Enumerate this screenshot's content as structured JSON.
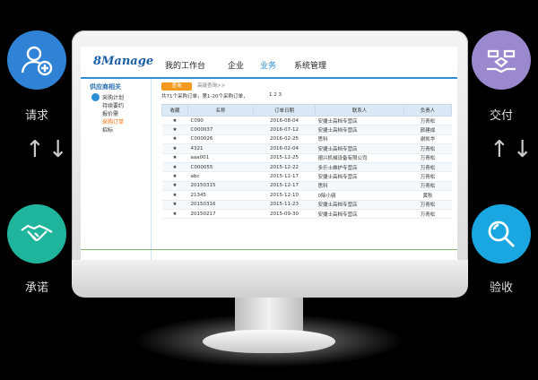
{
  "side": {
    "left_top_label": "请求",
    "left_bottom_label": "承诺",
    "right_top_label": "交付",
    "right_bottom_label": "验收",
    "colors": {
      "request": "#2f82d6",
      "promise": "#1fb49c",
      "deliver": "#9b89d0",
      "accept": "#1aa6e0"
    }
  },
  "app": {
    "logo": "8Manage",
    "nav": [
      "我的工作台",
      "企业",
      "业务",
      "系统管理"
    ],
    "active_nav": "业务"
  },
  "sidebar": {
    "title": "供应商相关",
    "items": [
      {
        "label": "采购计划"
      },
      {
        "label": "持续要约"
      },
      {
        "label": "报价需"
      },
      {
        "label": "采购订单"
      },
      {
        "label": "招标"
      }
    ]
  },
  "main": {
    "query_btn": "查询",
    "adv_link": "高级查询>>",
    "summary": "共71个采购订单，第1-20个采购订单，",
    "pages": "1 2 3",
    "columns": [
      "收藏",
      "名称",
      "订单日期",
      "联系人",
      "负责人"
    ],
    "rows": [
      {
        "star": "★",
        "name": "C090",
        "date": "2016-08-04",
        "contact": "安捷士高档专营店",
        "owner": "万青松"
      },
      {
        "star": "★",
        "name": "C000037",
        "date": "2016-07-12",
        "contact": "安捷士高档专营店",
        "owner": "颜建成"
      },
      {
        "star": "★",
        "name": "C000026",
        "date": "2016-02-25",
        "contact": "思科",
        "owner": "谢凯华"
      },
      {
        "star": "★",
        "name": "4321",
        "date": "2016-02-04",
        "contact": "安捷士高档专营店",
        "owner": "万青松"
      },
      {
        "star": "★",
        "name": "aaa001",
        "date": "2015-12-25",
        "contact": "德兴机械设备有限公司",
        "owner": "万青松"
      },
      {
        "star": "★",
        "name": "C000055",
        "date": "2015-12-22",
        "contact": "多乐士维护专营店",
        "owner": "万青松"
      },
      {
        "star": "★",
        "name": "abc",
        "date": "2015-12-17",
        "contact": "安捷士高档专营店",
        "owner": "万青松"
      },
      {
        "star": "★",
        "name": "20150315",
        "date": "2015-12-17",
        "contact": "思科",
        "owner": "万青松"
      },
      {
        "star": "★",
        "name": "21345",
        "date": "2015-12-10",
        "contact": "0除小骑",
        "owner": "黄秋"
      },
      {
        "star": "★",
        "name": "20150316",
        "date": "2015-11-23",
        "contact": "安捷士高档专营店",
        "owner": "万青松"
      },
      {
        "star": "★",
        "name": "20150217",
        "date": "2015-09-30",
        "contact": "安捷士高档专营店",
        "owner": "万青松"
      }
    ]
  }
}
